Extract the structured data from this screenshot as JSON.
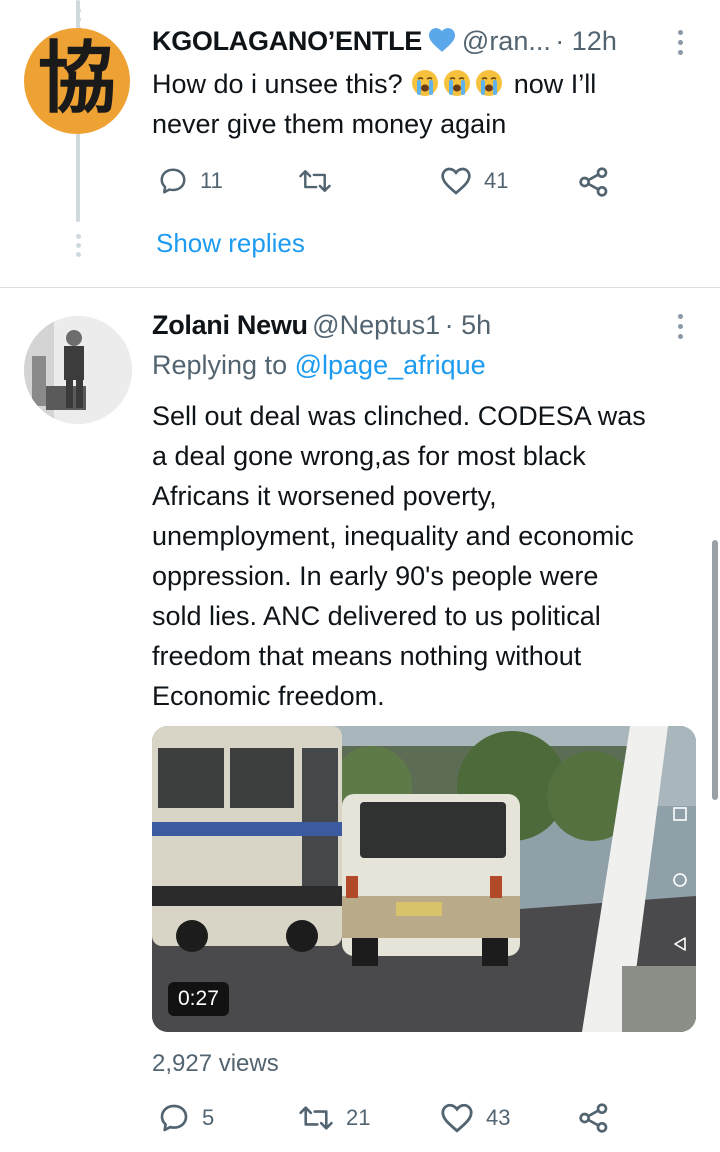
{
  "tweet1": {
    "avatar_glyph": "協",
    "name": "KGOLAGANO’ENTLE",
    "handle": "@ran...",
    "time": "· 12h",
    "text_line1": "How do i unsee this?",
    "text_line1_after": "now I’ll",
    "text_line2": "never give them money again",
    "emoji_count": 3,
    "replies": "11",
    "likes": "41",
    "show_replies": "Show replies"
  },
  "tweet2": {
    "name": "Zolani Newu",
    "handle": "@Neptus1",
    "time": "· 5h",
    "replying_prefix": "Replying to",
    "replying_to": "@lpage_afrique",
    "body_lines": [
      "Sell out deal was clinched. CODESA was",
      "a deal gone wrong,as for most black",
      "Africans it worsened poverty,",
      "unemployment, inequality and economic",
      "oppression. In early 90's people were",
      "sold lies. ANC delivered to us political",
      "freedom that means nothing without",
      "Economic freedom."
    ],
    "video_duration": "0:27",
    "views": "2,927 views",
    "replies": "5",
    "retweets": "21",
    "likes": "43"
  },
  "colors": {
    "accent": "#1d9bf0",
    "secondary_text": "#536471",
    "verified_heart": "#5aa8ea",
    "avatar1_bg": "#efa234"
  },
  "icons": [
    "reply-icon",
    "retweet-icon",
    "like-icon",
    "share-icon",
    "more-icon",
    "heart-badge-icon",
    "crying-emoji-icon"
  ]
}
